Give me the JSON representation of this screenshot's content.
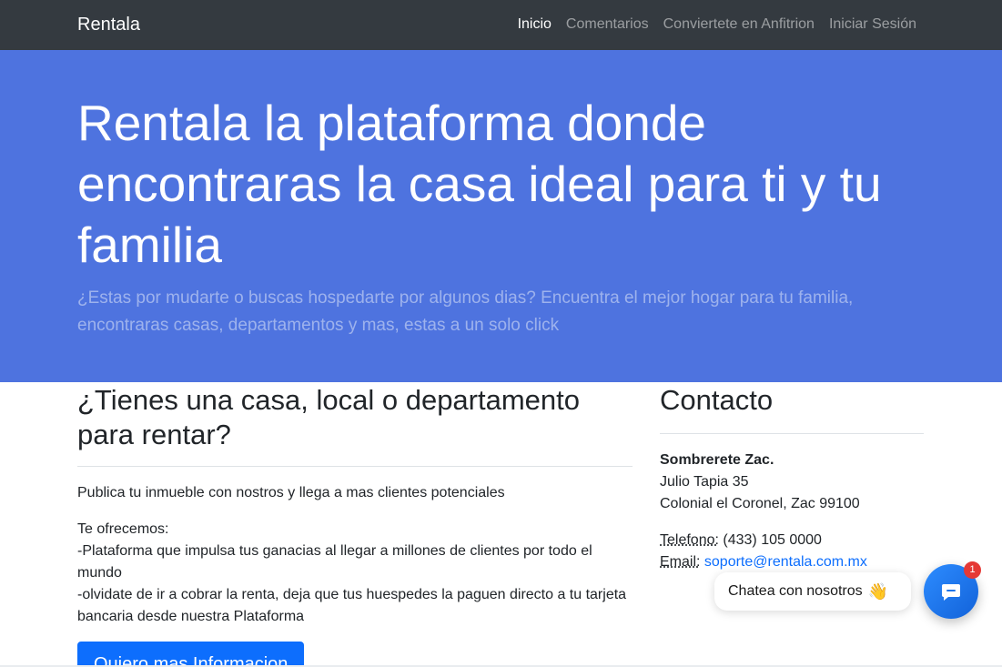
{
  "navbar": {
    "brand": "Rentala",
    "links": [
      "Inicio",
      "Comentarios",
      "Conviertete en Anfitrion",
      "Iniciar Sesión"
    ]
  },
  "hero": {
    "title": "Rentala la plataforma donde encontraras la casa ideal para ti y tu familia",
    "subtitle": "¿Estas por mudarte o buscas hospedarte por algunos dias? Encuentra el mejor hogar para tu familia, encontraras casas, departamentos y mas, estas a un solo click"
  },
  "rent_section": {
    "heading": "¿Tienes una casa, local o departamento para rentar?",
    "intro": "Publica tu inmueble con nostros y llega a mas clientes potenciales",
    "offer_title": "Te ofrecemos:",
    "offer_1": "-Plataforma que impulsa tus ganacias al llegar a millones de clientes por todo el mundo",
    "offer_2": "-olvidate de ir a cobrar la renta, deja que tus huespedes la paguen directo a tu tarjeta bancaria desde nuestra Plataforma",
    "button": "Quiero mas Informacion"
  },
  "contact": {
    "heading": "Contacto",
    "city": "Sombrerete Zac.",
    "street": "Julio Tapia 35",
    "colony": "Colonial el Coronel, Zac 99100",
    "phone_label": "Telefono:",
    "phone": "(433) 105 0000",
    "email_label": "Email:",
    "email": "soporte@rentala.com.mx"
  },
  "chat": {
    "label": "Chatea con nosotros",
    "wave": "👋",
    "badge": "1"
  },
  "colors": {
    "navbar": "#343a40",
    "hero": "#4e73df",
    "primary": "#0d6efd",
    "badge": "#e53935"
  }
}
